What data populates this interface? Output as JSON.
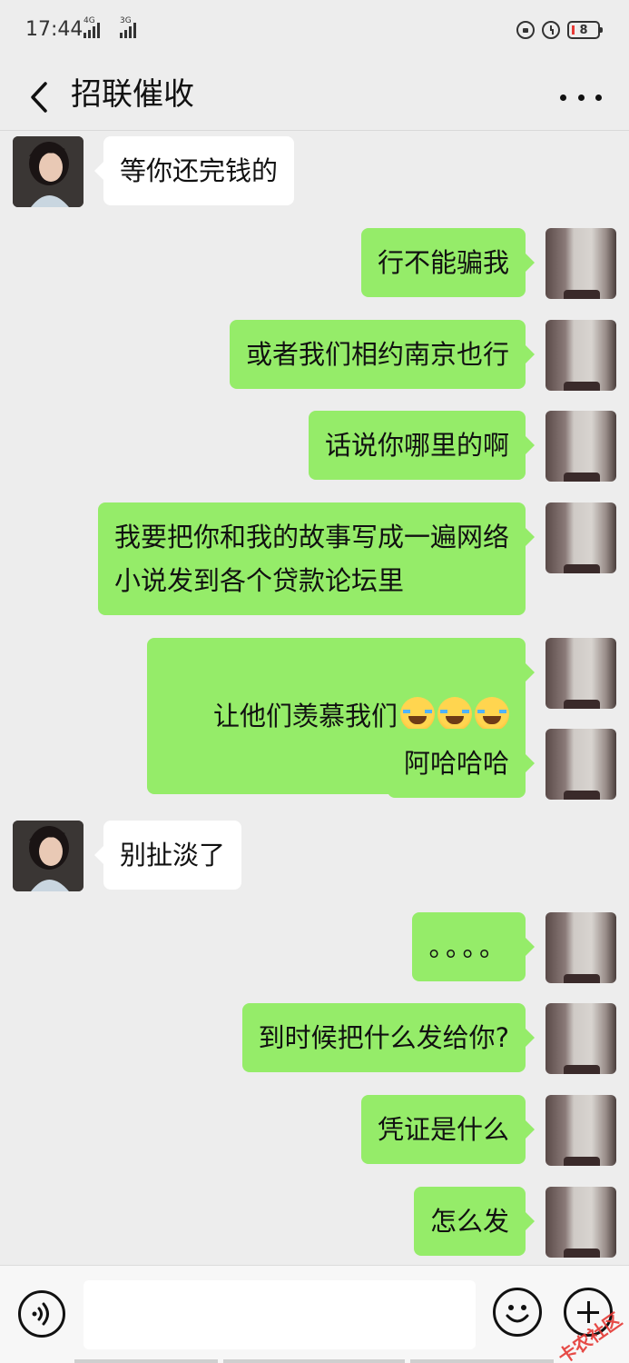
{
  "status_bar": {
    "time": "17:44",
    "network_1": "4G",
    "network_2": "3G",
    "battery": "8"
  },
  "header": {
    "title": "招联催收"
  },
  "messages": [
    {
      "side": "left",
      "text": "等你还完钱的",
      "emoji_count": 0
    },
    {
      "side": "right",
      "text": "行不能骗我",
      "emoji_count": 0
    },
    {
      "side": "right",
      "text": "或者我们相约南京也行",
      "emoji_count": 0
    },
    {
      "side": "right",
      "text": "话说你哪里的啊",
      "emoji_count": 0
    },
    {
      "side": "right",
      "text": "我要把你和我的故事写成一遍网络\n小说发到各个贷款论坛里",
      "emoji_count": 0
    },
    {
      "side": "right",
      "text": "让他们羡慕我们",
      "emoji_count": 3
    },
    {
      "side": "right",
      "text": "阿哈哈哈",
      "emoji_count": 0
    },
    {
      "side": "left",
      "text": "别扯淡了",
      "emoji_count": 0
    },
    {
      "side": "right",
      "text": "。。。。",
      "emoji_count": 0
    },
    {
      "side": "right",
      "text": "到时候把什么发给你?",
      "emoji_count": 0
    },
    {
      "side": "right",
      "text": "凭证是什么",
      "emoji_count": 0
    },
    {
      "side": "right",
      "text": "怎么发",
      "emoji_count": 0
    }
  ],
  "input": {
    "value": "",
    "placeholder": ""
  },
  "watermark": "卡农社区",
  "colors": {
    "background": "#ededed",
    "self_bubble": "#95ec69",
    "other_bubble": "#ffffff"
  }
}
